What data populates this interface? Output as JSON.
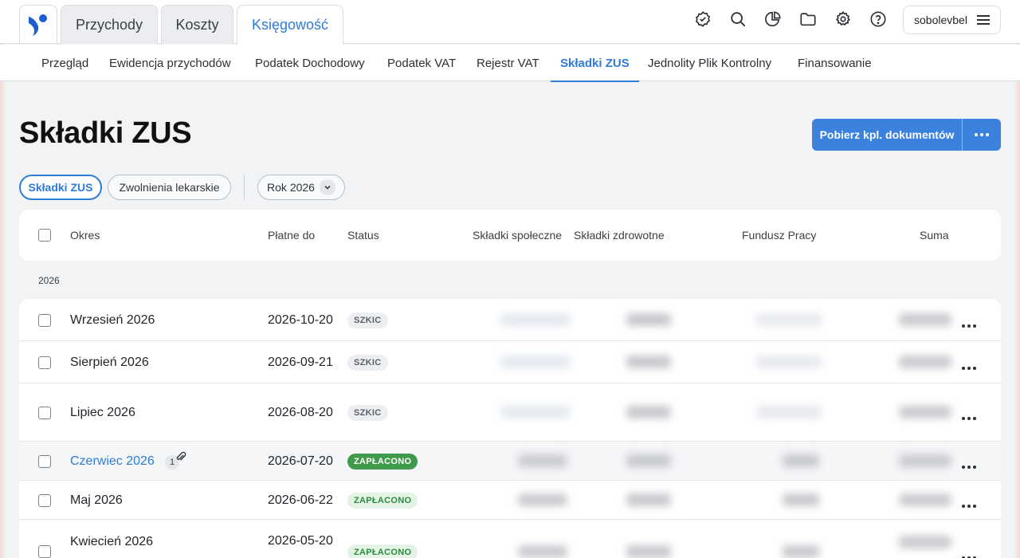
{
  "header": {
    "tabs": [
      {
        "label": "Przychody",
        "active": false
      },
      {
        "label": "Koszty",
        "active": false
      },
      {
        "label": "Księgowość",
        "active": true
      }
    ],
    "icons": [
      "badge-check-icon",
      "search-icon",
      "pie-chart-icon",
      "folder-icon",
      "gear-icon",
      "help-icon"
    ],
    "user": {
      "name": "sobolevbel"
    }
  },
  "subnav": {
    "items": [
      {
        "label": "Przegląd",
        "active": false
      },
      {
        "label": "Ewidencja przychodów",
        "active": false
      },
      {
        "label": "Podatek Dochodowy",
        "active": false
      },
      {
        "label": "Podatek VAT",
        "active": false
      },
      {
        "label": "Rejestr VAT",
        "active": false
      },
      {
        "label": "Składki ZUS",
        "active": true
      },
      {
        "label": "Jednolity Plik Kontrolny",
        "active": false
      },
      {
        "label": "Finansowanie",
        "active": false
      }
    ]
  },
  "page": {
    "title": "Składki ZUS",
    "primary_button": "Pobierz kpl. dokumentów"
  },
  "filters": {
    "chips": [
      {
        "label": "Składki ZUS",
        "active": true
      },
      {
        "label": "Zwolnienia lekarskie",
        "active": false
      }
    ],
    "year": {
      "label": "Rok 2026"
    }
  },
  "table": {
    "columns": {
      "okres": "Okres",
      "platne_do": "Płatne do",
      "status": "Status",
      "spoleczne": "Składki społeczne",
      "zdrowotne": "Składki zdrowotne",
      "fundusz": "Fundusz Pracy",
      "suma": "Suma"
    },
    "group_label": "2026",
    "rows": [
      {
        "okres": "Wrzesień 2026",
        "date": "2026-10-20",
        "status": "SZKIC"
      },
      {
        "okres": "Sierpień 2026",
        "date": "2026-09-21",
        "status": "SZKIC"
      },
      {
        "okres": "Lipiec 2026",
        "date": "2026-08-20",
        "status": "SZKIC"
      },
      {
        "okres": "Czerwiec 2026",
        "date": "2026-07-20",
        "status": "ZAPŁACONO",
        "attachments": "1"
      },
      {
        "okres": "Maj 2026",
        "date": "2026-06-22",
        "status": "ZAPŁACONO"
      },
      {
        "okres": "Kwiecień 2026",
        "date": "2026-05-20",
        "status": "ZAPŁACONO"
      }
    ]
  },
  "colors": {
    "accent": "#2f7bd8",
    "primary_button": "#3b82df",
    "paid_badge": "#3f9a4c",
    "background": "#f2f3f5"
  }
}
